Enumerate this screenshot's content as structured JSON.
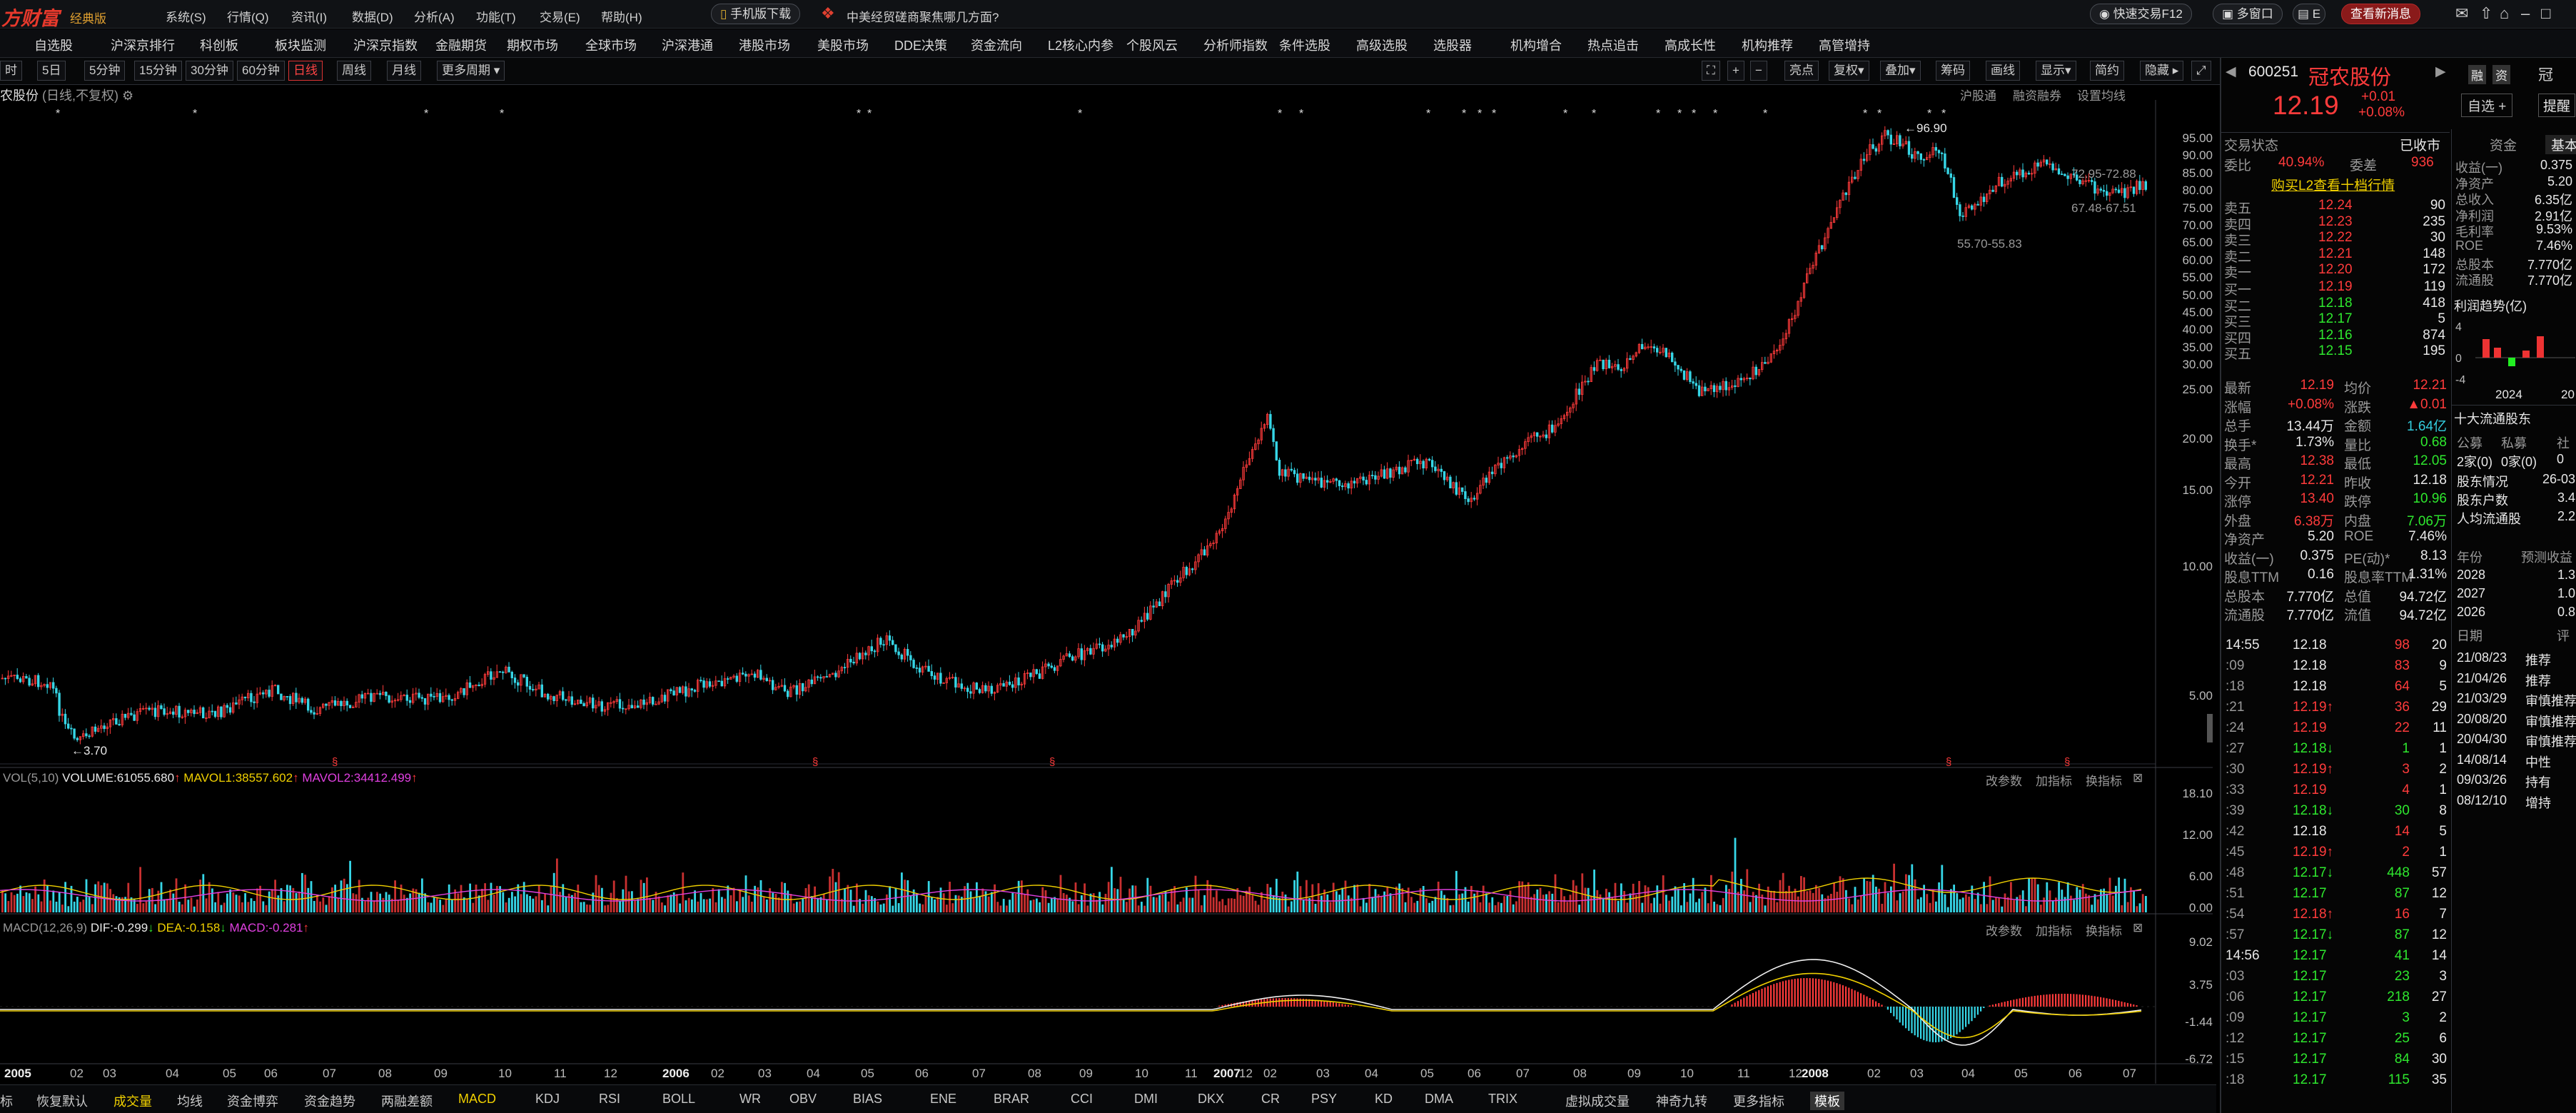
{
  "app": {
    "brand": "方财富",
    "edition": "经典版",
    "menus": [
      "系统(S)",
      "行情(Q)",
      "资讯(I)",
      "数据(D)",
      "分析(A)",
      "功能(T)",
      "交易(E)",
      "帮助(H)"
    ],
    "download": "手机版下载",
    "headline": "中美经贸磋商聚焦哪几方面?",
    "quick_trade": "快速交易F12",
    "multi_window": "多窗口",
    "view_news": "查看新消息",
    "partial": "E"
  },
  "nav": {
    "items": [
      "自选股",
      "沪深京排行",
      "科创板",
      "板块监测",
      "沪深京指数",
      "金融期货",
      "期权市场",
      "全球市场",
      "沪深港通",
      "港股市场",
      "美股市场",
      "DDE决策",
      "资金流向",
      "L2核心内参",
      "个股风云",
      "分析师指数",
      "条件选股",
      "高级选股",
      "选股器",
      "机构增合",
      "热点追击",
      "高成长性",
      "机构推荐",
      "高管增持"
    ]
  },
  "toolbar": {
    "periods": [
      "时",
      "5日",
      "5分钟",
      "15分钟",
      "30分钟",
      "60分钟",
      "日线",
      "周线",
      "月线",
      "更多周期"
    ],
    "selected": "日线",
    "right": [
      "亮点",
      "复权",
      "叠加",
      "筹码",
      "画线",
      "显示",
      "简约",
      "隐藏"
    ]
  },
  "chart": {
    "stock_label": "农股份",
    "adjust": "(日线,不复权)",
    "right_links": [
      "沪股通",
      "融资融券",
      "设置均线"
    ],
    "price_axis": [
      "95.00",
      "90.00",
      "85.00",
      "80.00",
      "75.00",
      "70.00",
      "65.00",
      "60.00",
      "55.00",
      "50.00",
      "45.00",
      "40.00",
      "35.00",
      "30.00",
      "25.00",
      "20.00",
      "15.00",
      "10.00",
      "5.00"
    ],
    "annot_high": "96.90",
    "annot_low": "3.70",
    "annot_mid": "55.70-55.83",
    "annot_a": "72.95-72.88",
    "annot_b": "67.48-67.51",
    "vol_header": {
      "name": "VOL(5,10)",
      "vol": "VOLUME:61055.680",
      "m1": "MAVOL1:38557.602",
      "m2": "MAVOL2:34412.499"
    },
    "vol_axis": [
      "18.10",
      "12.00",
      "6.00",
      "0.00"
    ],
    "macd_header": {
      "name": "MACD(12,26,9)",
      "dif": "DIF:-0.299",
      "dea": "DEA:-0.158",
      "macd": "MACD:-0.281"
    },
    "macd_axis": [
      "9.02",
      "3.75",
      "-1.44",
      "-6.72"
    ],
    "panel_links": [
      "改参数",
      "加指标",
      "换指标"
    ],
    "time_axis": [
      "2005",
      "02",
      "03",
      "04",
      "05",
      "06",
      "07",
      "08",
      "09",
      "10",
      "11",
      "12",
      "2006",
      "02",
      "03",
      "04",
      "05",
      "06",
      "07",
      "08",
      "09",
      "10",
      "11",
      "12",
      "2007",
      "02",
      "03",
      "04",
      "05",
      "06",
      "07",
      "08",
      "09",
      "10",
      "11",
      "12",
      "2008",
      "02",
      "03",
      "04",
      "05",
      "06",
      "07"
    ]
  },
  "bottom_tabs": [
    "标",
    "恢复默认",
    "成交量",
    "均线",
    "资金博弈",
    "资金趋势",
    "两融差额",
    "MACD",
    "KDJ",
    "RSI",
    "BOLL",
    "WR",
    "OBV",
    "BIAS",
    "ENE",
    "BRAR",
    "CCI",
    "DMI",
    "DKX",
    "CR",
    "PSY",
    "KD",
    "DMA",
    "TRIX",
    "虚拟成交量",
    "神奇九转",
    "更多指标",
    "模板"
  ],
  "quote": {
    "code": "600251",
    "name": "冠农股份",
    "tags": [
      "融",
      "资"
    ],
    "price": "12.19",
    "change": "+0.01",
    "pct": "+0.08%",
    "status_label": "交易状态",
    "status": "已收市",
    "wb_label": "委比",
    "wb": "40.94%",
    "wc_label": "委差",
    "wc": "936",
    "l2_link": "购买L2查看十档行情",
    "asks": [
      {
        "l": "卖五",
        "p": "12.24",
        "v": "90"
      },
      {
        "l": "卖四",
        "p": "12.23",
        "v": "235"
      },
      {
        "l": "卖三",
        "p": "12.22",
        "v": "30"
      },
      {
        "l": "卖二",
        "p": "12.21",
        "v": "148"
      },
      {
        "l": "卖一",
        "p": "12.20",
        "v": "172"
      }
    ],
    "bids": [
      {
        "l": "买一",
        "p": "12.19",
        "v": "119"
      },
      {
        "l": "买二",
        "p": "12.18",
        "v": "418"
      },
      {
        "l": "买三",
        "p": "12.17",
        "v": "5"
      },
      {
        "l": "买四",
        "p": "12.16",
        "v": "874"
      },
      {
        "l": "买五",
        "p": "12.15",
        "v": "195"
      }
    ],
    "stats": [
      [
        "最新",
        "12.19",
        "均价",
        "12.21"
      ],
      [
        "涨幅",
        "+0.08%",
        "涨跌",
        "▲0.01"
      ],
      [
        "总手",
        "13.44万",
        "金额",
        "1.64亿"
      ],
      [
        "换手*",
        "1.73%",
        "量比",
        "0.68"
      ],
      [
        "最高",
        "12.38",
        "最低",
        "12.05"
      ],
      [
        "今开",
        "12.21",
        "昨收",
        "12.18"
      ],
      [
        "涨停",
        "13.40",
        "跌停",
        "10.96"
      ],
      [
        "外盘",
        "6.38万",
        "内盘",
        "7.06万"
      ],
      [
        "净资产",
        "5.20",
        "ROE",
        "7.46%"
      ],
      [
        "收益(一)",
        "0.375",
        "PE(动)*",
        "8.13"
      ],
      [
        "股息TTM",
        "0.16",
        "股息率TTM",
        "1.31%"
      ],
      [
        "总股本",
        "7.770亿",
        "总值",
        "94.72亿"
      ],
      [
        "流通股",
        "7.770亿",
        "流值",
        "94.72亿"
      ]
    ],
    "ticks": [
      [
        "14:55",
        "12.18",
        "98",
        "20"
      ],
      [
        ":09",
        "12.18",
        "83",
        "9"
      ],
      [
        ":18",
        "12.18",
        "64",
        "5"
      ],
      [
        ":21",
        "12.19↑",
        "36",
        "29"
      ],
      [
        ":24",
        "12.19",
        "22",
        "11"
      ],
      [
        ":27",
        "12.18↓",
        "1",
        "1"
      ],
      [
        ":30",
        "12.19↑",
        "3",
        "2"
      ],
      [
        ":33",
        "12.19",
        "4",
        "1"
      ],
      [
        ":39",
        "12.18↓",
        "30",
        "8"
      ],
      [
        ":42",
        "12.18",
        "14",
        "5"
      ],
      [
        ":45",
        "12.19↑",
        "2",
        "1"
      ],
      [
        ":48",
        "12.17↓",
        "448",
        "57"
      ],
      [
        ":51",
        "12.17",
        "87",
        "12"
      ],
      [
        ":54",
        "12.18↑",
        "16",
        "7"
      ],
      [
        ":57",
        "12.17↓",
        "87",
        "12"
      ],
      [
        "14:56",
        "12.17",
        "41",
        "14"
      ],
      [
        ":03",
        "12.17",
        "23",
        "3"
      ],
      [
        ":06",
        "12.17",
        "218",
        "27"
      ],
      [
        ":09",
        "12.17",
        "3",
        "2"
      ],
      [
        ":12",
        "12.17",
        "25",
        "6"
      ],
      [
        ":15",
        "12.17",
        "84",
        "30"
      ],
      [
        ":18",
        "12.17",
        "115",
        "35"
      ]
    ],
    "tabs2": [
      "资金",
      "基本"
    ],
    "fin": [
      [
        "收益(一)",
        "0.375"
      ],
      [
        "净资产",
        "5.20"
      ],
      [
        "总收入",
        "6.35亿"
      ],
      [
        "净利润",
        "2.91亿"
      ],
      [
        "毛利率",
        "9.53%"
      ],
      [
        "ROE",
        "7.46%"
      ],
      [
        "总股本",
        "7.770亿"
      ],
      [
        "流通股",
        "7.770亿"
      ]
    ],
    "profit_trend": "利润趋势(亿)",
    "years": [
      "2024",
      "20"
    ],
    "holders_title": "十大流通股东",
    "holders": [
      [
        "公募",
        "私募",
        "社"
      ],
      [
        "2家(0)",
        "0家(0)",
        "0"
      ]
    ],
    "holder_info": [
      [
        "股东情况",
        "26-03"
      ],
      [
        "股东户数",
        "3.4"
      ],
      [
        "人均流通股",
        "2.2"
      ]
    ],
    "forecast_title": [
      "年份",
      "预测收益"
    ],
    "forecast": [
      [
        "2028",
        "1.3"
      ],
      [
        "2027",
        "1.0"
      ],
      [
        "2026",
        "0.8"
      ]
    ],
    "rating_title": [
      "日期",
      "评"
    ],
    "ratings": [
      [
        "21/08/23",
        "推荐"
      ],
      [
        "21/04/26",
        "推荐"
      ],
      [
        "21/03/29",
        "审慎推荐"
      ],
      [
        "20/08/20",
        "审慎推荐"
      ],
      [
        "20/04/30",
        "审慎推荐"
      ],
      [
        "14/08/14",
        "中性"
      ],
      [
        "09/03/26",
        "持有"
      ],
      [
        "08/12/10",
        "增持"
      ]
    ],
    "buttons": [
      "自选 +",
      "提醒"
    ],
    "stock_short": "冠"
  }
}
